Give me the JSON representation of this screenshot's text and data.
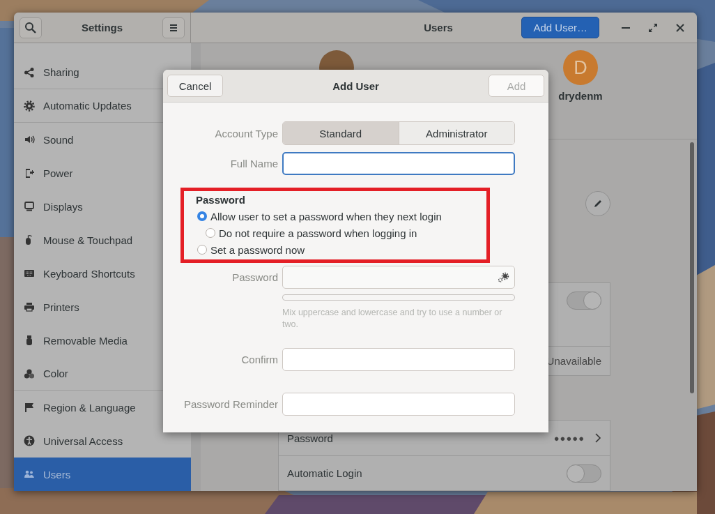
{
  "window": {
    "sidebar_title": "Settings",
    "title": "Users",
    "add_button": "Add User…"
  },
  "sidebar": {
    "items": [
      {
        "label": "Sharing",
        "selected": false,
        "divider_below": true
      },
      {
        "label": "Automatic Updates",
        "selected": false,
        "divider_below": true
      },
      {
        "label": "Sound",
        "selected": false,
        "divider_below": false
      },
      {
        "label": "Power",
        "selected": false,
        "divider_below": false
      },
      {
        "label": "Displays",
        "selected": false,
        "divider_below": false
      },
      {
        "label": "Mouse & Touchpad",
        "selected": false,
        "divider_below": false
      },
      {
        "label": "Keyboard Shortcuts",
        "selected": false,
        "divider_below": false
      },
      {
        "label": "Printers",
        "selected": false,
        "divider_below": false
      },
      {
        "label": "Removable Media",
        "selected": false,
        "divider_below": false
      },
      {
        "label": "Color",
        "selected": false,
        "divider_below": true
      },
      {
        "label": "Region & Language",
        "selected": false,
        "divider_below": false
      },
      {
        "label": "Universal Access",
        "selected": false,
        "divider_below": false
      },
      {
        "label": "Users",
        "selected": true,
        "divider_below": false
      }
    ]
  },
  "users": [
    {
      "color": "#7d5a3a"
    },
    {
      "initial": "D",
      "name": "drydenm",
      "color": "#c87a2f"
    }
  ],
  "cards": [
    {
      "rows": [
        {
          "kind": "toggle",
          "on": true
        },
        {
          "kind": "value",
          "value": "Unavailable"
        }
      ]
    },
    {
      "rows": [
        {
          "kind": "link",
          "label": "Password",
          "value": "●●●●●"
        },
        {
          "kind": "toggle",
          "label": "Automatic Login",
          "on": false
        }
      ]
    }
  ],
  "dialog": {
    "title": "Add User",
    "cancel": "Cancel",
    "confirm": {
      "label": "Add",
      "disabled": true
    },
    "account_type": {
      "label": "Account Type",
      "options": [
        {
          "label": "Standard",
          "selected": true
        },
        {
          "label": "Administrator",
          "selected": false
        }
      ]
    },
    "full_name": {
      "label": "Full Name",
      "focused": true
    },
    "password_section": {
      "title": "Password",
      "highlighted": true,
      "options": [
        {
          "label": "Allow user to set a password when they next login",
          "selected": true,
          "children": [
            {
              "label": "Do not require a password when logging in",
              "selected": false
            }
          ]
        },
        {
          "label": "Set a password now",
          "selected": false
        }
      ]
    },
    "password": {
      "label": "Password",
      "strength": {
        "level": 0
      },
      "hint": "Mix uppercase and lowercase and try to use a number or two."
    },
    "confirm_field": {
      "label": "Confirm"
    },
    "reminder": {
      "label": "Password Reminder"
    }
  }
}
